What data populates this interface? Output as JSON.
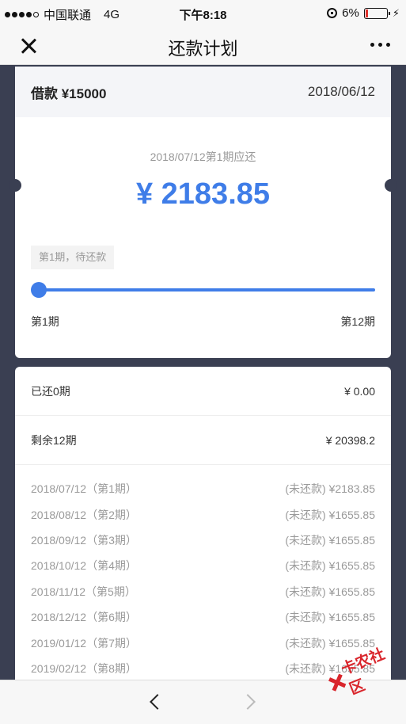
{
  "status_bar": {
    "carrier": "中国联通",
    "network": "4G",
    "time": "下午8:18",
    "battery": "6%",
    "battery_level": 0.06
  },
  "nav": {
    "title": "还款计划",
    "close_icon": "close-icon",
    "more_icon": "more-icon"
  },
  "loan": {
    "label": "借款 ¥15000",
    "date": "2018/06/12",
    "due_label": "2018/07/12第1期应还",
    "due_amount": "¥ 2183.85",
    "status": "第1期，待还款",
    "progress": 0,
    "range_start": "第1期",
    "range_end": "第12期"
  },
  "summary": [
    {
      "label": "已还0期",
      "value": "¥ 0.00"
    },
    {
      "label": "剩余12期",
      "value": "¥ 20398.2"
    }
  ],
  "schedule": [
    {
      "date": "2018/07/12（第1期）",
      "amount": "(未还款) ¥2183.85"
    },
    {
      "date": "2018/08/12（第2期）",
      "amount": "(未还款) ¥1655.85"
    },
    {
      "date": "2018/09/12（第3期）",
      "amount": "(未还款) ¥1655.85"
    },
    {
      "date": "2018/10/12（第4期）",
      "amount": "(未还款) ¥1655.85"
    },
    {
      "date": "2018/11/12（第5期）",
      "amount": "(未还款) ¥1655.85"
    },
    {
      "date": "2018/12/12（第6期）",
      "amount": "(未还款) ¥1655.85"
    },
    {
      "date": "2019/01/12（第7期）",
      "amount": "(未还款) ¥1655.85"
    },
    {
      "date": "2019/02/12（第8期）",
      "amount": "(未还款) ¥1655.85"
    }
  ],
  "bottom_bar": {
    "back_icon": "chevron-left-icon",
    "forward_icon": "chevron-right-icon"
  },
  "watermark": {
    "text": "卡农社区",
    "color": "#d9262c"
  },
  "colors": {
    "accent": "#3f7de8",
    "background": "#3a3f52"
  }
}
